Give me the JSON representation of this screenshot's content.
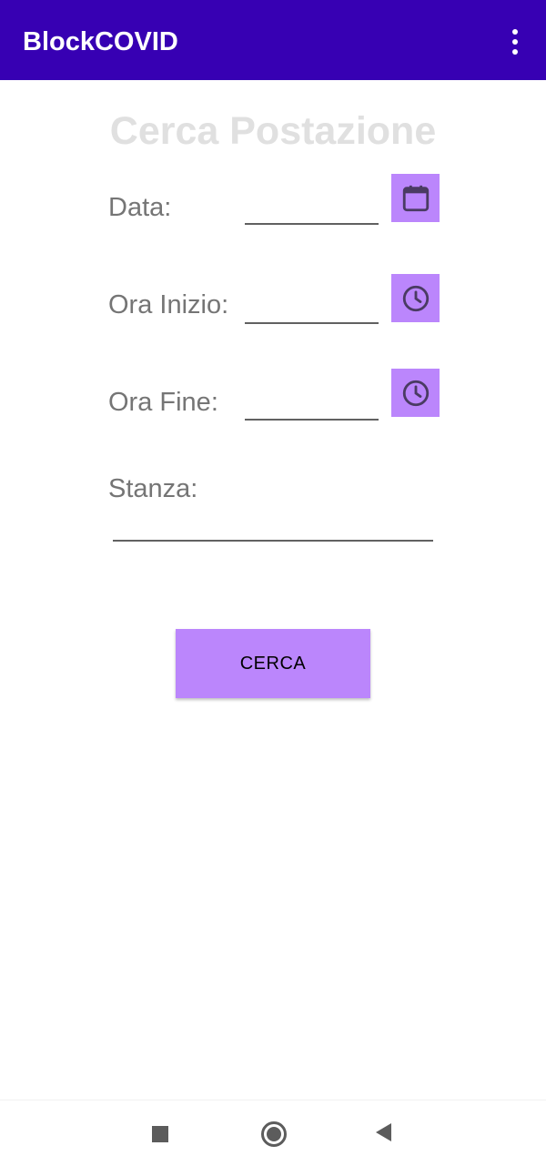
{
  "app_bar": {
    "title": "BlockCOVID",
    "menu_icon": "more-vert-icon"
  },
  "page": {
    "title": "Cerca Postazione"
  },
  "form": {
    "data": {
      "label": "Data:",
      "value": "",
      "icon": "calendar-icon"
    },
    "ora_inizio": {
      "label": "Ora Inizio:",
      "value": "",
      "icon": "clock-icon"
    },
    "ora_fine": {
      "label": "Ora Fine:",
      "value": "",
      "icon": "clock-icon"
    },
    "stanza": {
      "label": "Stanza:",
      "value": ""
    },
    "submit_label": "CERCA"
  },
  "nav_bar": {
    "recents_icon": "square-icon",
    "home_icon": "circle-icon",
    "back_icon": "triangle-back-icon"
  },
  "colors": {
    "primary": "#3700b3",
    "accent": "#bb86fc",
    "icon_tint": "#4a3b63",
    "label": "#757575",
    "title_faded": "#e0e0e0"
  }
}
